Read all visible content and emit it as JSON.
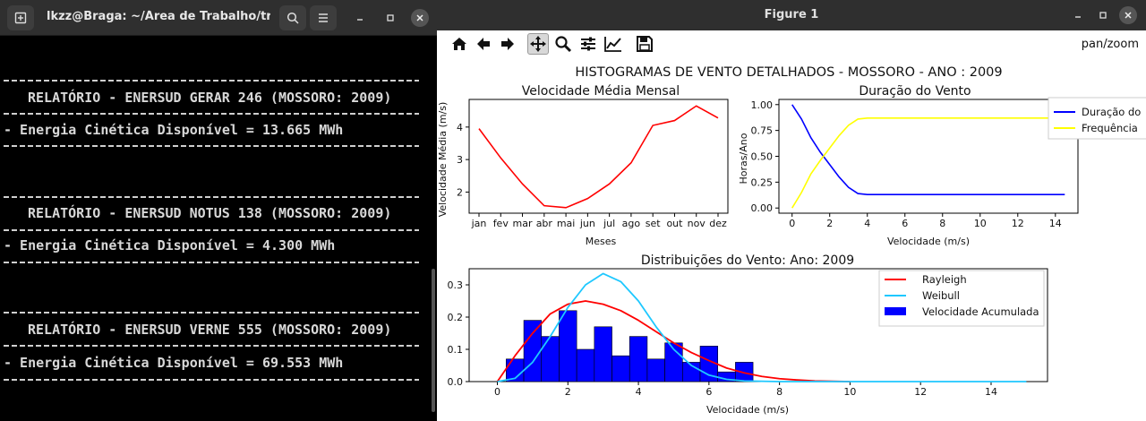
{
  "terminal": {
    "title": "lkzz@Braga: ~/Área de Trabalho/traba...",
    "reports": [
      {
        "header": "RELATÓRIO - ENERSUD GERAR 246 (MOSSORO: 2009)",
        "line": "- Energia Cinética Disponível = 13.665 MWh"
      },
      {
        "header": "RELATÓRIO - ENERSUD NOTUS 138 (MOSSORO: 2009)",
        "line": "- Energia Cinética Disponível = 4.300 MWh"
      },
      {
        "header": "RELATÓRIO - ENERSUD VERNE 555 (MOSSORO: 2009)",
        "line": "- Energia Cinética Disponível = 69.553 MWh"
      }
    ]
  },
  "figure": {
    "window_title": "Figure 1",
    "mode": "pan/zoom",
    "suptitle": "HISTOGRAMAS DE VENTO DETALHADOS - MOSSORO - ANO : 2009",
    "toolbar_icons": [
      "home-icon",
      "back-icon",
      "forward-icon",
      "pan-icon",
      "zoom-icon",
      "configure-icon",
      "edit-axis-icon",
      "save-icon"
    ]
  },
  "chart_data": [
    {
      "type": "line",
      "title": "Velocidade Média Mensal",
      "xlabel": "Meses",
      "ylabel": "Velocidade Média (m/s)",
      "categories": [
        "jan",
        "fev",
        "mar",
        "abr",
        "mai",
        "jun",
        "jul",
        "ago",
        "set",
        "out",
        "nov",
        "dez"
      ],
      "series": [
        {
          "values": [
            3.95,
            3.05,
            2.25,
            1.58,
            1.52,
            1.8,
            2.25,
            2.9,
            4.05,
            4.2,
            4.65,
            4.28
          ],
          "color": "#ff0000"
        }
      ],
      "ylim": [
        1.35,
        4.85
      ],
      "yticks": [
        2,
        3,
        4
      ],
      "grid": false
    },
    {
      "type": "line",
      "title": "Duração do Vento",
      "xlabel": "Velocidade (m/s)",
      "ylabel": "Horas/Ano",
      "xlim": [
        -0.7,
        15.2
      ],
      "ylim": [
        -0.05,
        1.05
      ],
      "xticks": [
        0,
        2,
        4,
        6,
        8,
        10,
        12,
        14
      ],
      "yticks": [
        0.0,
        0.25,
        0.5,
        0.75,
        1.0
      ],
      "ytick_labels": [
        "0.00",
        "0.25",
        "0.50",
        "0.75",
        "1.00"
      ],
      "legend_position": "top-right-outside",
      "series": [
        {
          "name": "Duração do",
          "color": "#0000ff",
          "x": [
            0,
            0.5,
            1,
            1.5,
            2,
            2.5,
            3,
            3.5,
            4,
            5,
            6,
            8,
            10,
            12,
            14.5
          ],
          "y": [
            1.0,
            0.86,
            0.68,
            0.54,
            0.42,
            0.3,
            0.2,
            0.14,
            0.13,
            0.13,
            0.13,
            0.13,
            0.13,
            0.13,
            0.13
          ]
        },
        {
          "name": "Frequência",
          "color": "#ffff00",
          "x": [
            0,
            0.5,
            1,
            1.5,
            2,
            2.5,
            3,
            3.5,
            4,
            5,
            6,
            8,
            10,
            12,
            14.5
          ],
          "y": [
            0.0,
            0.15,
            0.33,
            0.46,
            0.58,
            0.7,
            0.8,
            0.86,
            0.87,
            0.87,
            0.87,
            0.87,
            0.87,
            0.87,
            0.87
          ]
        }
      ]
    },
    {
      "type": "bar",
      "title": "Distribuições do Vento: Ano: 2009",
      "xlabel": "Velocidade (m/s)",
      "ylabel": "Frequência",
      "xlim": [
        -0.8,
        15.6
      ],
      "ylim": [
        0,
        0.35
      ],
      "xticks": [
        0,
        2,
        4,
        6,
        8,
        10,
        12,
        14
      ],
      "yticks": [
        0.0,
        0.1,
        0.2,
        0.3
      ],
      "legend_position": "top-right",
      "histogram": {
        "name": "Velocidade Acumulada",
        "color": "#0000ff",
        "bin_width": 0.5,
        "bins_start": [
          0.25,
          0.75,
          1.25,
          1.75,
          2.25,
          2.75,
          3.25,
          3.75,
          4.25,
          4.75,
          5.25,
          5.75,
          6.25,
          6.75
        ],
        "values": [
          0.07,
          0.19,
          0.14,
          0.22,
          0.1,
          0.17,
          0.08,
          0.14,
          0.07,
          0.12,
          0.06,
          0.11,
          0.03,
          0.06
        ]
      },
      "series": [
        {
          "name": "Rayleigh",
          "color": "#ff0000",
          "x": [
            0,
            0.5,
            1,
            1.5,
            2,
            2.5,
            3,
            3.5,
            4,
            4.5,
            5,
            5.5,
            6,
            6.5,
            7,
            7.5,
            8,
            8.5,
            9,
            10
          ],
          "y": [
            0,
            0.08,
            0.15,
            0.21,
            0.24,
            0.25,
            0.24,
            0.22,
            0.19,
            0.155,
            0.12,
            0.09,
            0.065,
            0.042,
            0.027,
            0.016,
            0.009,
            0.005,
            0.002,
            0
          ]
        },
        {
          "name": "Weibull",
          "color": "#1ec8ff",
          "x": [
            0,
            0.5,
            1,
            1.5,
            2,
            2.5,
            3,
            3.5,
            4,
            4.5,
            5,
            5.5,
            6,
            6.5,
            7,
            8,
            10,
            15
          ],
          "y": [
            0,
            0.01,
            0.06,
            0.14,
            0.23,
            0.3,
            0.335,
            0.31,
            0.25,
            0.17,
            0.1,
            0.05,
            0.02,
            0.007,
            0.002,
            0,
            0,
            0
          ]
        }
      ]
    }
  ]
}
